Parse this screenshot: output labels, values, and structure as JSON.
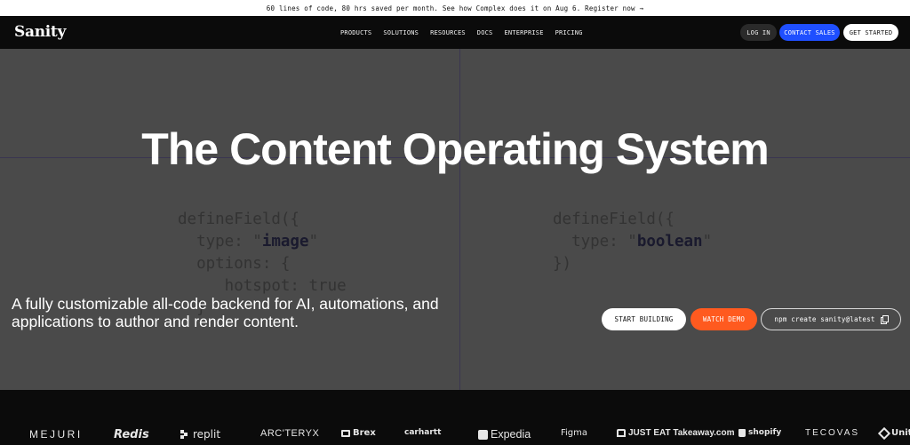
{
  "banner": {
    "text": "60 lines of code, 80 hrs saved per month. See how Complex does it on Aug 6. Register now →"
  },
  "nav": {
    "logo": "Sanity",
    "menu": [
      "PRODUCTS",
      "SOLUTIONS",
      "RESOURCES",
      "DOCS",
      "ENTERPRISE",
      "PRICING"
    ],
    "login": "LOG IN",
    "contact": "CONTACT SALES",
    "get_started": "GET STARTED",
    "colors": {
      "contact_bg": "#1f4fff",
      "nav_bg": "#0b0b0b"
    }
  },
  "hero": {
    "title": "The Content Operating System",
    "subtitle": "A fully customizable all-code backend for AI, automations, and applications to author and render content.",
    "code_left": {
      "l1": "defineField({",
      "l2a": "  type: \"",
      "l2b": "image",
      "l2c": "\"",
      "l3": "  options: {",
      "l4": "     hotspot: true",
      "l5": "  }"
    },
    "code_right": {
      "l1": "defineField({",
      "l2a": "  type: \"",
      "l2b": "boolean",
      "l2c": "\"",
      "l3": "})"
    },
    "start_building": "START BUILDING",
    "watch_demo": "WATCH DEMO",
    "npm_command": "npm create sanity@latest",
    "colors": {
      "hero_bg": "#4a4a4a",
      "demo_bg": "#ff5a1f"
    }
  },
  "logos": {
    "mejuri": "MEJURI",
    "redis": "Redis",
    "replit": "replit",
    "arcteryx": "ARC'TERYX",
    "brex": "Brex",
    "carhartt": "carhartt",
    "expedia": "Expedia",
    "figma": "Figma",
    "justeat": "JUST EAT Takeaway.com",
    "shopify": "shopify",
    "tecovas": "TECOVAS",
    "unity": "Unity"
  }
}
